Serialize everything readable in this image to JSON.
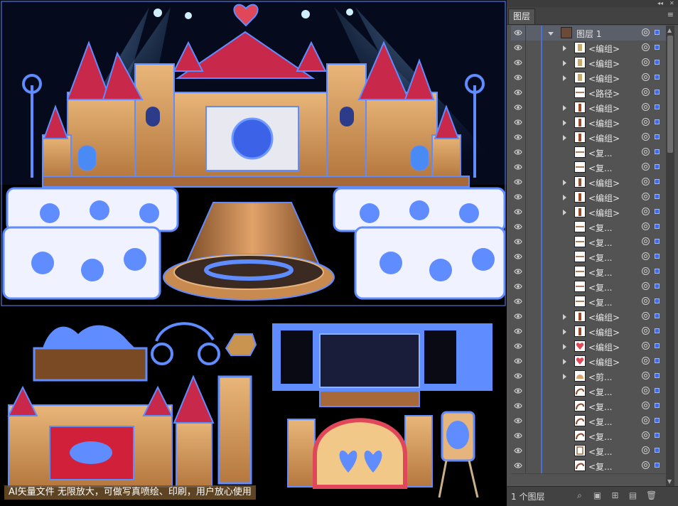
{
  "canvas": {
    "watermark": "AI矢量文件 无限放大，可做写真喷绘、印刷，用户放心使用"
  },
  "panel": {
    "tab_label": "图层",
    "menu_icon": "≡",
    "layer_count": "1 个图层",
    "colors": {
      "selection": "#3b6cf0",
      "layer_stripe": "#4b6fd9",
      "panel_bg": "#535353"
    },
    "root_layer": {
      "name": "图层 1",
      "expanded": true
    },
    "items": [
      {
        "label": "<编组>",
        "has_arrow": true,
        "thumb": "figure"
      },
      {
        "label": "<编组>",
        "has_arrow": true,
        "thumb": "figure"
      },
      {
        "label": "<编组>",
        "has_arrow": true,
        "thumb": "figure"
      },
      {
        "label": "<路径>",
        "has_arrow": false,
        "thumb": "line"
      },
      {
        "label": "<编组>",
        "has_arrow": true,
        "thumb": "bottle"
      },
      {
        "label": "<编组>",
        "has_arrow": true,
        "thumb": "bottle"
      },
      {
        "label": "<编组>",
        "has_arrow": true,
        "thumb": "bottle"
      },
      {
        "label": "<复...",
        "has_arrow": false,
        "thumb": "line"
      },
      {
        "label": "<复...",
        "has_arrow": false,
        "thumb": "line"
      },
      {
        "label": "<编组>",
        "has_arrow": true,
        "thumb": "bottle"
      },
      {
        "label": "<编组>",
        "has_arrow": true,
        "thumb": "bottle"
      },
      {
        "label": "<编组>",
        "has_arrow": true,
        "thumb": "bottle"
      },
      {
        "label": "<复...",
        "has_arrow": false,
        "thumb": "line"
      },
      {
        "label": "<复...",
        "has_arrow": false,
        "thumb": "line"
      },
      {
        "label": "<复...",
        "has_arrow": false,
        "thumb": "line"
      },
      {
        "label": "<复...",
        "has_arrow": false,
        "thumb": "line"
      },
      {
        "label": "<复...",
        "has_arrow": false,
        "thumb": "line"
      },
      {
        "label": "<复...",
        "has_arrow": false,
        "thumb": "line"
      },
      {
        "label": "<编组>",
        "has_arrow": true,
        "thumb": "bottle"
      },
      {
        "label": "<编组>",
        "has_arrow": true,
        "thumb": "bottle"
      },
      {
        "label": "<编组>",
        "has_arrow": true,
        "thumb": "heart"
      },
      {
        "label": "<编组>",
        "has_arrow": true,
        "thumb": "heart"
      },
      {
        "label": "<剪...",
        "has_arrow": true,
        "thumb": "dome"
      },
      {
        "label": "<复...",
        "has_arrow": false,
        "thumb": "swirl"
      },
      {
        "label": "<复...",
        "has_arrow": false,
        "thumb": "swirl"
      },
      {
        "label": "<复...",
        "has_arrow": false,
        "thumb": "swirl"
      },
      {
        "label": "<复...",
        "has_arrow": false,
        "thumb": "swirl"
      },
      {
        "label": "<复...",
        "has_arrow": false,
        "thumb": "frame"
      },
      {
        "label": "<复...",
        "has_arrow": false,
        "thumb": "swirl"
      }
    ]
  }
}
